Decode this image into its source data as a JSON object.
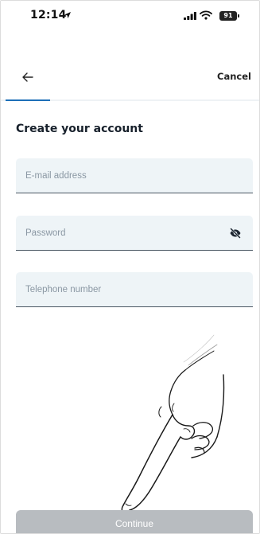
{
  "status_bar": {
    "time": "12:14",
    "battery_level": "91",
    "icons": [
      "location-arrow-icon",
      "cellular-signal-icon",
      "wifi-icon",
      "battery-icon"
    ]
  },
  "nav": {
    "back_icon": "arrow-left-icon",
    "cancel_label": "Cancel",
    "progress_fraction": 0.17,
    "progress_color": "#1d6fb8"
  },
  "form": {
    "title": "Create your account",
    "email": {
      "placeholder": "E-mail address",
      "value": ""
    },
    "password": {
      "placeholder": "Password",
      "value": "",
      "toggle_icon": "eye-slash-icon"
    },
    "phone": {
      "placeholder": "Telephone number",
      "value": ""
    }
  },
  "overlay": {
    "icon": "pointing-hand-icon"
  },
  "actions": {
    "continue_label": "Continue",
    "continue_color": "#b8bcc0"
  }
}
